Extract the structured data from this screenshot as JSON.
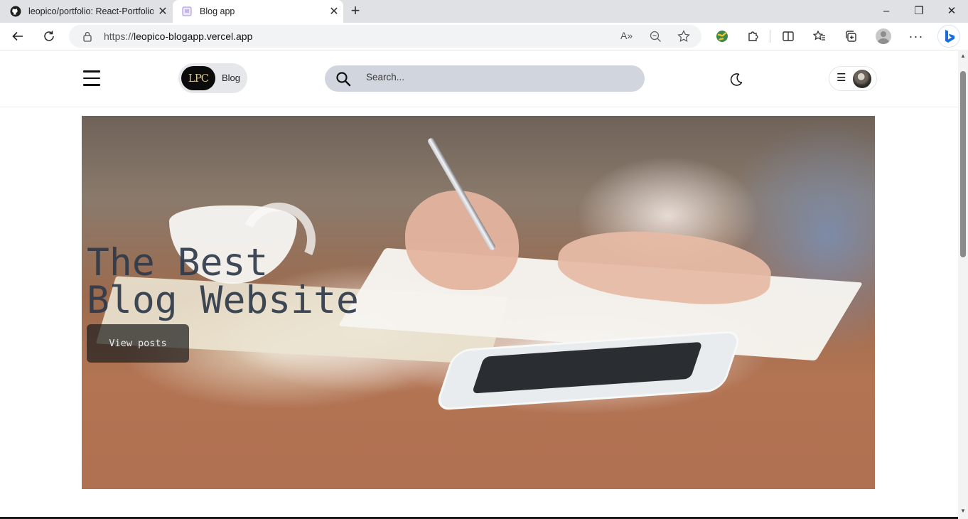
{
  "browser": {
    "tabs": [
      {
        "title": "leopico/portfolio: React-Portfolio",
        "icon": "github-icon",
        "active": false
      },
      {
        "title": "Blog app",
        "icon": "page-icon",
        "active": true
      }
    ],
    "new_tab_label": "+",
    "window_controls": {
      "minimize": "–",
      "maximize": "❐",
      "close": "✕"
    },
    "address": {
      "protocol": "https://",
      "domain": "leopico-blogapp.vercel.app"
    },
    "toolbar_icons": [
      "back-icon",
      "refresh-icon",
      "lock-icon",
      "read-aloud-icon",
      "zoom-icon",
      "favorite-star-icon",
      "extension-globe-icon",
      "extensions-icon",
      "split-screen-icon",
      "favorites-icon",
      "collections-icon",
      "profile-icon",
      "more-icon",
      "bing-icon"
    ]
  },
  "site": {
    "brand_logo_text": "LPC",
    "brand_label": "Blog",
    "search_placeholder": "Search...",
    "theme_icon": "moon-icon",
    "hero": {
      "title": "The Best\nBlog Website",
      "button": "View posts"
    }
  }
}
